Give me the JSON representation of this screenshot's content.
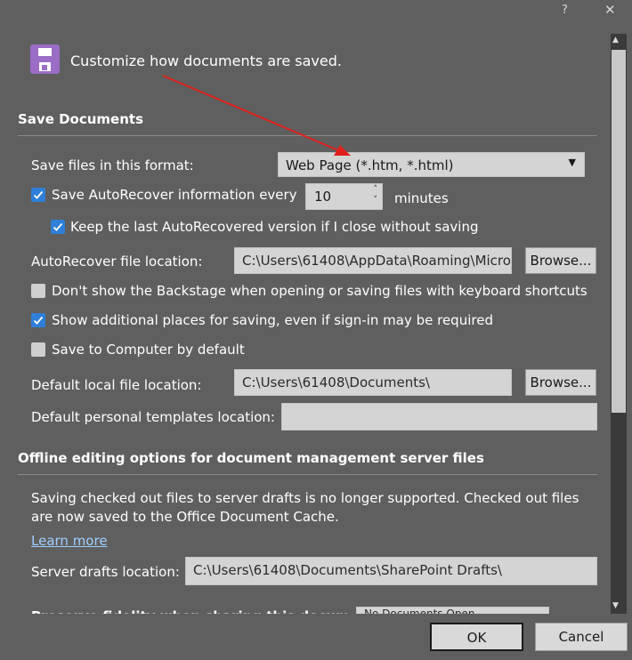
{
  "titlebar": {
    "help": "?",
    "close": "✕"
  },
  "header": {
    "title": "Customize how documents are saved."
  },
  "save_section": {
    "heading": "Save Documents",
    "format_label": "Save files in this format:",
    "format_value": "Web Page (*.htm, *.html)",
    "autorecover_label": "Save AutoRecover information every",
    "autorecover_minutes": "10",
    "minutes_label": "minutes",
    "keep_last_label": "Keep the last AutoRecovered version if I close without saving",
    "ar_location_label": "AutoRecover file location:",
    "ar_location_value": "C:\\Users\\61408\\AppData\\Roaming\\Micro",
    "browse_label": "Browse...",
    "backstage_label": "Don't show the Backstage when opening or saving files with keyboard shortcuts",
    "additional_places_label": "Show additional places for saving, even if sign-in may be required",
    "save_computer_label": "Save to Computer by default",
    "local_location_label": "Default local file location:",
    "local_location_value": "C:\\Users\\61408\\Documents\\",
    "templates_label": "Default personal templates location:",
    "templates_value": ""
  },
  "offline_section": {
    "heading": "Offline editing options for document management server files",
    "info": "Saving checked out files to server drafts is no longer supported. Checked out files are now saved to the Office Document Cache.",
    "learn_more": "Learn more",
    "drafts_label": "Server drafts location:",
    "drafts_value": "C:\\Users\\61408\\Documents\\SharePoint Drafts\\"
  },
  "partial_row": {
    "label": "Preserve fidelity when sharing this document:",
    "value": "No Documents Open"
  },
  "footer": {
    "ok": "OK",
    "cancel": "Cancel"
  },
  "colors": {
    "background": "#5f5f5f",
    "checkbox": "#2f7fd8",
    "annotation_arrow": "#e0201b"
  }
}
